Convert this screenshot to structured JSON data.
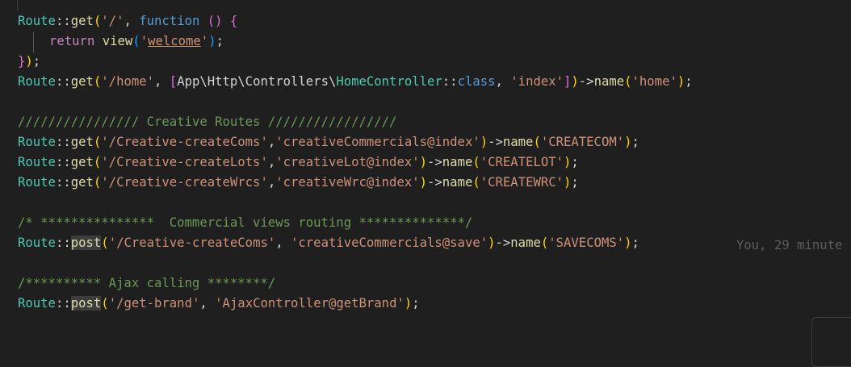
{
  "colors": {
    "background": "#1f1f1f",
    "class": "#4ec9b0",
    "method": "#dcdcaa",
    "string": "#ce9178",
    "keyword": "#c586c0",
    "storage": "#569cd6",
    "comment": "#6a9955",
    "punct": "#d4d4d4",
    "bracket1": "#ffd700",
    "bracket2": "#da70d6",
    "bracket3": "#179fff"
  },
  "code_lines": [
    {
      "tokens": [
        {
          "t": "Route",
          "c": "class"
        },
        {
          "t": "::",
          "c": "punct"
        },
        {
          "t": "get",
          "c": "method"
        },
        {
          "t": "(",
          "c": "bracket1"
        },
        {
          "t": "'/'",
          "c": "string"
        },
        {
          "t": ", ",
          "c": "punct"
        },
        {
          "t": "function",
          "c": "storage"
        },
        {
          "t": " ",
          "c": "punct"
        },
        {
          "t": "()",
          "c": "bracket2"
        },
        {
          "t": " ",
          "c": "punct"
        },
        {
          "t": "{",
          "c": "bracket2"
        }
      ]
    },
    {
      "indent": true,
      "tokens": [
        {
          "t": "return",
          "c": "keyword"
        },
        {
          "t": " ",
          "c": "punct"
        },
        {
          "t": "view",
          "c": "method"
        },
        {
          "t": "(",
          "c": "bracket3"
        },
        {
          "t": "'",
          "c": "string"
        },
        {
          "t": "welcome",
          "c": "string",
          "u": true
        },
        {
          "t": "'",
          "c": "string"
        },
        {
          "t": ")",
          "c": "bracket3"
        },
        {
          "t": ";",
          "c": "punct"
        }
      ]
    },
    {
      "tokens": [
        {
          "t": "}",
          "c": "bracket2"
        },
        {
          "t": ")",
          "c": "bracket1"
        },
        {
          "t": ";",
          "c": "punct"
        }
      ]
    },
    {
      "tokens": [
        {
          "t": "Route",
          "c": "class"
        },
        {
          "t": "::",
          "c": "punct"
        },
        {
          "t": "get",
          "c": "method"
        },
        {
          "t": "(",
          "c": "bracket1"
        },
        {
          "t": "'/home'",
          "c": "string"
        },
        {
          "t": ", ",
          "c": "punct"
        },
        {
          "t": "[",
          "c": "bracket2"
        },
        {
          "t": "App\\Http\\Controllers\\",
          "c": "punct"
        },
        {
          "t": "HomeController",
          "c": "class"
        },
        {
          "t": "::",
          "c": "punct"
        },
        {
          "t": "class",
          "c": "storage"
        },
        {
          "t": ", ",
          "c": "punct"
        },
        {
          "t": "'index'",
          "c": "string"
        },
        {
          "t": "]",
          "c": "bracket2"
        },
        {
          "t": ")",
          "c": "bracket1"
        },
        {
          "t": "->",
          "c": "punct"
        },
        {
          "t": "name",
          "c": "method"
        },
        {
          "t": "(",
          "c": "bracket1"
        },
        {
          "t": "'home'",
          "c": "string"
        },
        {
          "t": ")",
          "c": "bracket1"
        },
        {
          "t": ";",
          "c": "punct"
        }
      ]
    },
    {
      "tokens": []
    },
    {
      "tokens": [
        {
          "t": "//////////////// Creative Routes /////////////////",
          "c": "comment"
        }
      ]
    },
    {
      "tokens": [
        {
          "t": "Route",
          "c": "class"
        },
        {
          "t": "::",
          "c": "punct"
        },
        {
          "t": "get",
          "c": "method"
        },
        {
          "t": "(",
          "c": "bracket1"
        },
        {
          "t": "'/Creative-createComs'",
          "c": "string"
        },
        {
          "t": ",",
          "c": "punct"
        },
        {
          "t": "'creativeCommercials@index'",
          "c": "string"
        },
        {
          "t": ")",
          "c": "bracket1"
        },
        {
          "t": "->",
          "c": "punct"
        },
        {
          "t": "name",
          "c": "method"
        },
        {
          "t": "(",
          "c": "bracket1"
        },
        {
          "t": "'CREATECOM'",
          "c": "string"
        },
        {
          "t": ")",
          "c": "bracket1"
        },
        {
          "t": ";",
          "c": "punct"
        }
      ]
    },
    {
      "tokens": [
        {
          "t": "Route",
          "c": "class"
        },
        {
          "t": "::",
          "c": "punct"
        },
        {
          "t": "get",
          "c": "method"
        },
        {
          "t": "(",
          "c": "bracket1"
        },
        {
          "t": "'/Creative-createLots'",
          "c": "string"
        },
        {
          "t": ",",
          "c": "punct"
        },
        {
          "t": "'creativeLot@index'",
          "c": "string"
        },
        {
          "t": ")",
          "c": "bracket1"
        },
        {
          "t": "->",
          "c": "punct"
        },
        {
          "t": "name",
          "c": "method"
        },
        {
          "t": "(",
          "c": "bracket1"
        },
        {
          "t": "'CREATELOT'",
          "c": "string"
        },
        {
          "t": ")",
          "c": "bracket1"
        },
        {
          "t": ";",
          "c": "punct"
        }
      ]
    },
    {
      "tokens": [
        {
          "t": "Route",
          "c": "class"
        },
        {
          "t": "::",
          "c": "punct"
        },
        {
          "t": "get",
          "c": "method"
        },
        {
          "t": "(",
          "c": "bracket1"
        },
        {
          "t": "'/Creative-createWrcs'",
          "c": "string"
        },
        {
          "t": ",",
          "c": "punct"
        },
        {
          "t": "'creativeWrc@index'",
          "c": "string"
        },
        {
          "t": ")",
          "c": "bracket1"
        },
        {
          "t": "->",
          "c": "punct"
        },
        {
          "t": "name",
          "c": "method"
        },
        {
          "t": "(",
          "c": "bracket1"
        },
        {
          "t": "'CREATEWRC'",
          "c": "string"
        },
        {
          "t": ")",
          "c": "bracket1"
        },
        {
          "t": ";",
          "c": "punct"
        }
      ]
    },
    {
      "tokens": []
    },
    {
      "tokens": [
        {
          "t": "/* ***************  Commercial views routing **************/",
          "c": "comment"
        }
      ]
    },
    {
      "tokens": [
        {
          "t": "Route",
          "c": "class"
        },
        {
          "t": "::",
          "c": "punct"
        },
        {
          "t": "post",
          "c": "method",
          "h": true
        },
        {
          "t": "(",
          "c": "bracket1"
        },
        {
          "t": "'/Creative-createComs'",
          "c": "string"
        },
        {
          "t": ", ",
          "c": "punct"
        },
        {
          "t": "'creativeCommercials@save'",
          "c": "string"
        },
        {
          "t": ")",
          "c": "bracket1"
        },
        {
          "t": "->",
          "c": "punct"
        },
        {
          "t": "name",
          "c": "method"
        },
        {
          "t": "(",
          "c": "bracket1"
        },
        {
          "t": "'SAVECOMS'",
          "c": "string"
        },
        {
          "t": ")",
          "c": "bracket1"
        },
        {
          "t": ";",
          "c": "punct"
        }
      ]
    },
    {
      "tokens": []
    },
    {
      "tokens": [
        {
          "t": "/********** Ajax calling ********/",
          "c": "comment"
        }
      ]
    },
    {
      "tokens": [
        {
          "t": "Route",
          "c": "class"
        },
        {
          "t": "::",
          "c": "punct"
        },
        {
          "t": "post",
          "c": "method",
          "h": true
        },
        {
          "t": "(",
          "c": "bracket1"
        },
        {
          "t": "'/get-brand'",
          "c": "string"
        },
        {
          "t": ", ",
          "c": "punct"
        },
        {
          "t": "'AjaxController@getBrand'",
          "c": "string"
        },
        {
          "t": ")",
          "c": "bracket1"
        },
        {
          "t": ";",
          "c": "punct"
        }
      ]
    }
  ],
  "blame_annotation": "You, 29 minute"
}
